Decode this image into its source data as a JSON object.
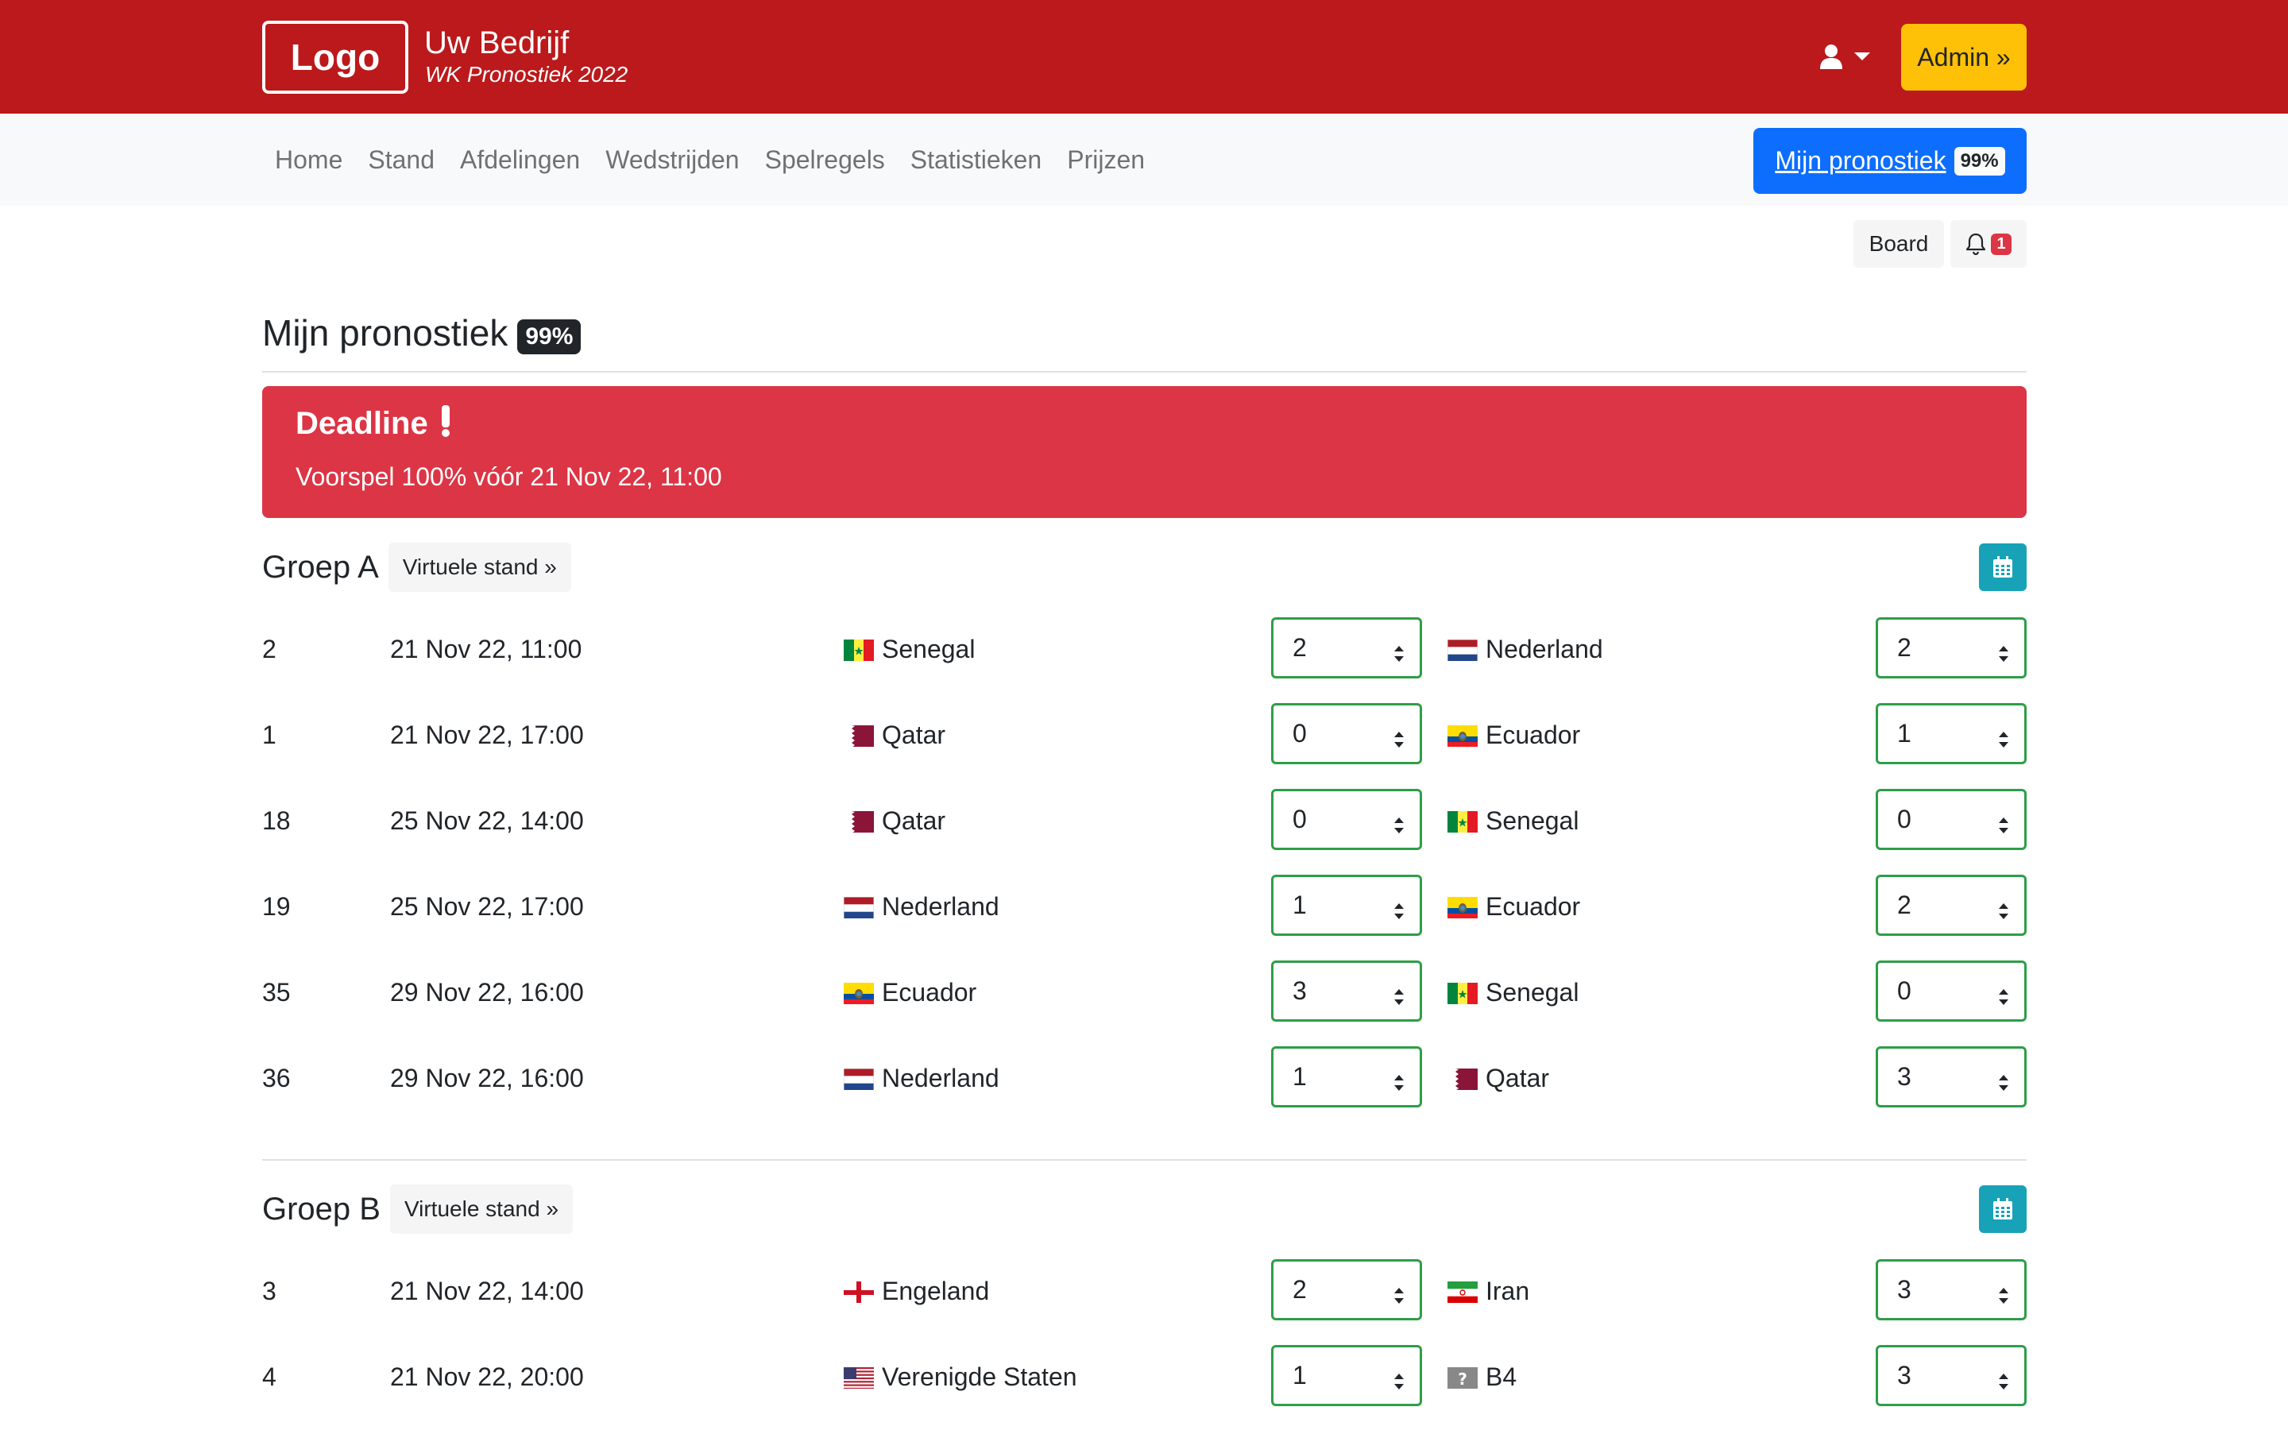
{
  "header": {
    "logo": "Logo",
    "company": "Uw Bedrijf",
    "subtitle": "WK Pronostiek 2022",
    "user_icon": "user-icon",
    "admin_label": "Admin »"
  },
  "nav": {
    "links": [
      "Home",
      "Stand",
      "Afdelingen",
      "Wedstrijden",
      "Spelregels",
      "Statistieken",
      "Prijzen"
    ],
    "mine_label": "Mijn pronostiek",
    "mine_pct": "99%"
  },
  "toolbar": {
    "board_label": "Board",
    "bell_icon": "bell-icon",
    "bell_count": "1"
  },
  "page": {
    "title": "Mijn pronostiek",
    "title_pct": "99%"
  },
  "deadline": {
    "title": "Deadline",
    "text": "Voorspel 100% vóór 21 Nov 22, 11:00"
  },
  "colors": {
    "header_red": "#bb191b",
    "alert_red": "#dc3545",
    "primary_blue": "#0d6efd",
    "admin_yellow": "#ffc107",
    "calendar_teal": "#17a2b8",
    "select_green": "#2e9e48"
  },
  "groups": [
    {
      "title": "Groep A",
      "virtual_label": "Virtuele stand »",
      "matches": [
        {
          "num": "2",
          "date": "21 Nov 22, 11:00",
          "home": "Senegal",
          "home_flag": "sn",
          "home_score": "2",
          "away": "Nederland",
          "away_flag": "nl",
          "away_score": "2"
        },
        {
          "num": "1",
          "date": "21 Nov 22, 17:00",
          "home": "Qatar",
          "home_flag": "qa",
          "home_score": "0",
          "away": "Ecuador",
          "away_flag": "ec",
          "away_score": "1"
        },
        {
          "num": "18",
          "date": "25 Nov 22, 14:00",
          "home": "Qatar",
          "home_flag": "qa",
          "home_score": "0",
          "away": "Senegal",
          "away_flag": "sn",
          "away_score": "0"
        },
        {
          "num": "19",
          "date": "25 Nov 22, 17:00",
          "home": "Nederland",
          "home_flag": "nl",
          "home_score": "1",
          "away": "Ecuador",
          "away_flag": "ec",
          "away_score": "2"
        },
        {
          "num": "35",
          "date": "29 Nov 22, 16:00",
          "home": "Ecuador",
          "home_flag": "ec",
          "home_score": "3",
          "away": "Senegal",
          "away_flag": "sn",
          "away_score": "0"
        },
        {
          "num": "36",
          "date": "29 Nov 22, 16:00",
          "home": "Nederland",
          "home_flag": "nl",
          "home_score": "1",
          "away": "Qatar",
          "away_flag": "qa",
          "away_score": "3"
        }
      ]
    },
    {
      "title": "Groep B",
      "virtual_label": "Virtuele stand »",
      "matches": [
        {
          "num": "3",
          "date": "21 Nov 22, 14:00",
          "home": "Engeland",
          "home_flag": "en",
          "home_score": "2",
          "away": "Iran",
          "away_flag": "ir",
          "away_score": "3"
        },
        {
          "num": "4",
          "date": "21 Nov 22, 20:00",
          "home": "Verenigde Staten",
          "home_flag": "us",
          "home_score": "1",
          "away": "B4",
          "away_flag": "unknown",
          "away_score": "3"
        }
      ]
    }
  ]
}
